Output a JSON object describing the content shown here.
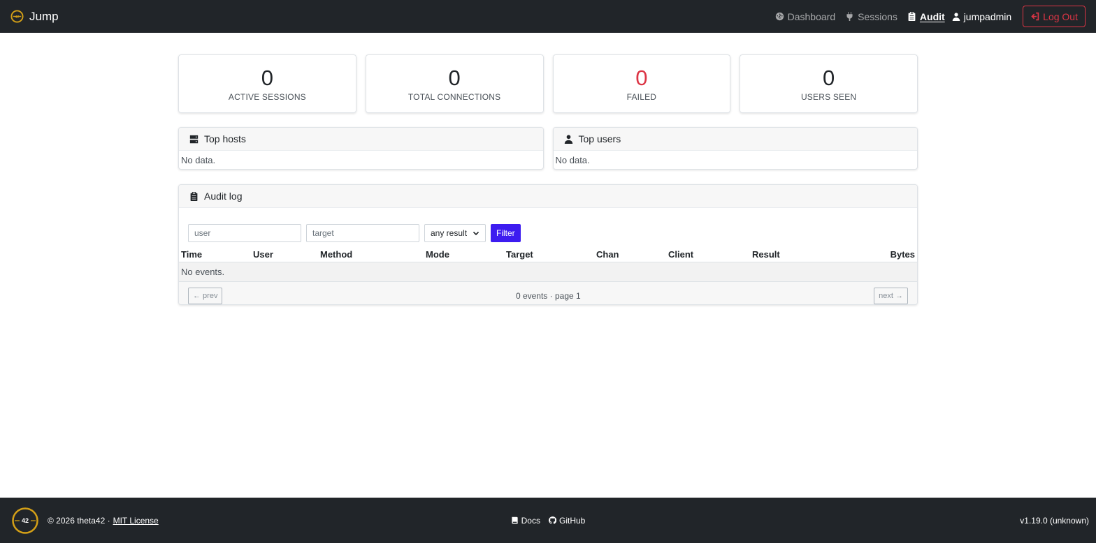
{
  "app": {
    "title": "Jump"
  },
  "nav": {
    "dashboard": "Dashboard",
    "sessions": "Sessions",
    "audit": "Audit",
    "user": "jumpadmin",
    "logout": "Log Out"
  },
  "stats": [
    {
      "value": "0",
      "label": "ACTIVE SESSIONS"
    },
    {
      "value": "0",
      "label": "TOTAL CONNECTIONS"
    },
    {
      "value": "0",
      "label": "FAILED"
    },
    {
      "value": "0",
      "label": "USERS SEEN"
    }
  ],
  "top_hosts": {
    "title": "Top hosts",
    "empty": "No data."
  },
  "top_users": {
    "title": "Top users",
    "empty": "No data."
  },
  "audit": {
    "title": "Audit log",
    "filters": {
      "user_placeholder": "user",
      "target_placeholder": "target",
      "result_selected": "any result",
      "filter_label": "Filter"
    },
    "columns": [
      "Time",
      "User",
      "Method",
      "Mode",
      "Target",
      "Chan",
      "Client",
      "Result",
      "Bytes"
    ],
    "empty": "No events.",
    "pager": {
      "prev": "← prev",
      "info": "0 events · page 1",
      "next": "next →"
    }
  },
  "footer": {
    "logo_text": "42",
    "copyright": "© 2026 theta42 ·",
    "license": "MIT License",
    "docs": "Docs",
    "github": "GitHub",
    "version": "v1.19.0 (unknown)"
  },
  "colors": {
    "navbar_bg": "#212529",
    "danger": "#dc3545",
    "primary": "#3d1cf0",
    "logo_gold": "#d4a017"
  }
}
